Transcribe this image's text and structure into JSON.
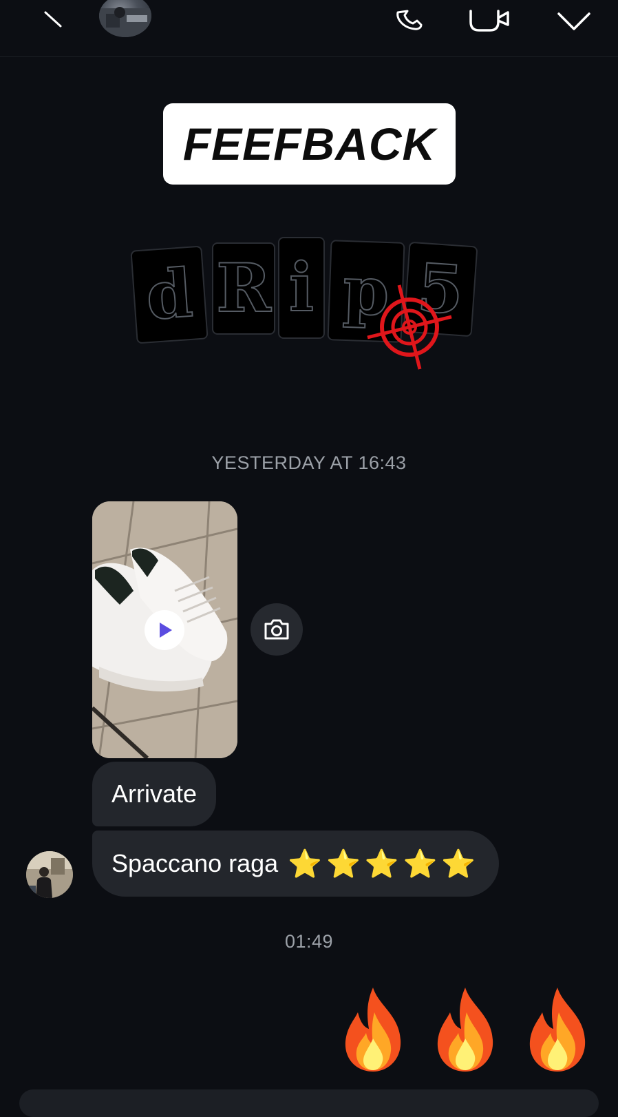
{
  "header": {
    "name": "",
    "icons": [
      "back-icon",
      "call-icon",
      "video-icon",
      "chevron-down-icon"
    ]
  },
  "banner": {
    "text": "FEEFBACK"
  },
  "logo": {
    "letters": [
      "d",
      "R",
      "i",
      "p",
      "5"
    ],
    "accent_color": "#e0161b"
  },
  "timestamps": {
    "first": "YESTERDAY AT 16:43",
    "second": "01:49"
  },
  "messages": [
    {
      "type": "video",
      "icon": "play-icon"
    },
    {
      "type": "text",
      "text": "Arrivate"
    },
    {
      "type": "text",
      "text": "Spaccano raga",
      "emoji": "⭐⭐⭐⭐⭐"
    }
  ],
  "reply": {
    "emoji": [
      "🔥",
      "🔥",
      "🔥"
    ]
  },
  "colors": {
    "background": "#0c0e13",
    "bubble": "#23262c",
    "play": "#5b4ce0"
  }
}
